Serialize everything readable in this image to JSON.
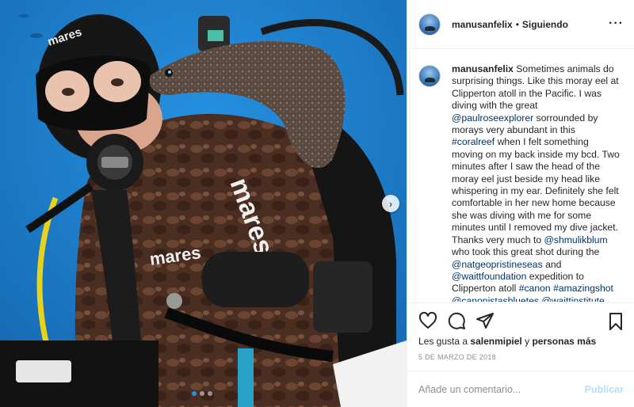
{
  "post": {
    "username": "manusanfelix",
    "separator": "•",
    "follow_status": "Siguiendo",
    "more_icon": "more-horizontal-icon",
    "caption_parts": [
      {
        "t": "Sometimes animals do surprising things. Like this moray eel at Clipperton atoll in the Pacific. I was diving with the great ",
        "link": false
      },
      {
        "t": "@paulroseexplorer",
        "link": true
      },
      {
        "t": " sorrounded by morays very abundant in this ",
        "link": false
      },
      {
        "t": "#coralreef",
        "link": true
      },
      {
        "t": " when I felt something moving on my back inside my bcd. Two minutes after I saw the head of the moray eel just beside my head like whispering in my ear. Definitely she felt comfortable in her new home because she was diving with me for some minutes until I removed my dive jacket. Thanks very much to ",
        "link": false
      },
      {
        "t": "@shmulikblum",
        "link": true
      },
      {
        "t": " who took this great shot during the ",
        "link": false
      },
      {
        "t": "@natgeopristineseas",
        "link": true
      },
      {
        "t": " and ",
        "link": false
      },
      {
        "t": "@waittfoundation",
        "link": true
      },
      {
        "t": " expedition to Clipperton atoll ",
        "link": false
      },
      {
        "t": "#canon",
        "link": true
      },
      {
        "t": " ",
        "link": false
      },
      {
        "t": "#amazingshot",
        "link": true
      },
      {
        "t": " ",
        "link": false
      },
      {
        "t": "@canonistasbluetes",
        "link": true
      },
      {
        "t": " ",
        "link": false
      },
      {
        "t": "@waittinstitute",
        "link": true
      }
    ],
    "likes_prefix": "Les gusta a",
    "likes_user": "salenmipiel",
    "likes_join": "y",
    "likes_others": "personas más",
    "date": "5 DE MARZO DE 2018",
    "comment_placeholder": "Añade un comentario...",
    "publish_label": "Publicar"
  },
  "photo": {
    "gear_brand": "mares",
    "mask_brand": "mares",
    "carousel_total": 3,
    "carousel_active": 1,
    "next_icon": "chevron-right-icon"
  },
  "colors": {
    "link": "#003569",
    "publish": "#b2dffc",
    "water": "#1b7fd0",
    "carousel_active": "#1a95f0"
  }
}
